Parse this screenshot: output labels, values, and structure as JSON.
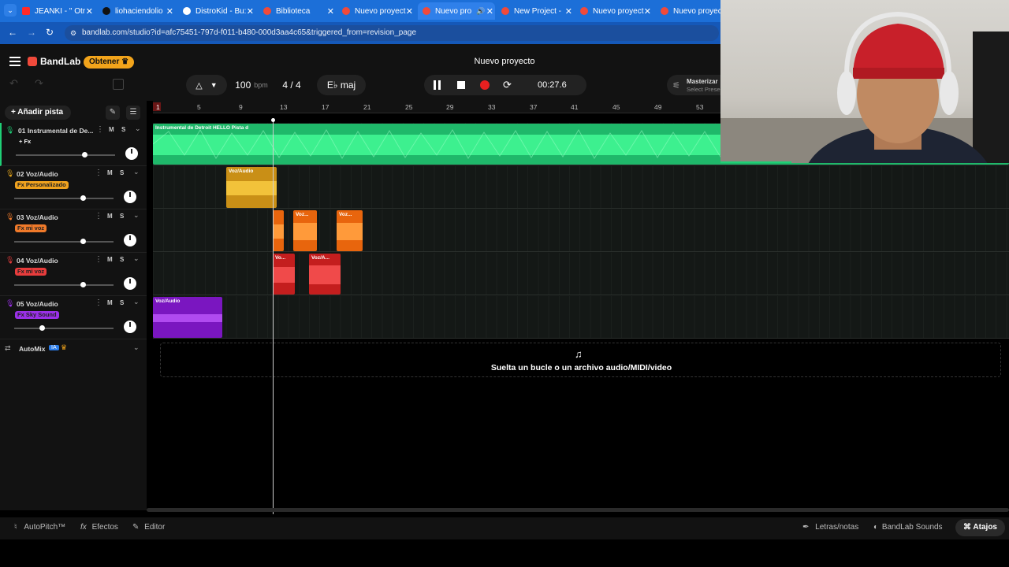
{
  "browser": {
    "tabs": [
      {
        "label": "JEANKI - \" Otr",
        "color": "#ff2a2a"
      },
      {
        "label": "liohaciendolio",
        "color": "#111111"
      },
      {
        "label": "DistroKid - Bu:",
        "color": "#ffffff"
      },
      {
        "label": "Biblioteca",
        "color": "#f04a3b"
      },
      {
        "label": "Nuevo proyect",
        "color": "#f04a3b"
      },
      {
        "label": "Nuevo pro",
        "color": "#f04a3b"
      },
      {
        "label": "New Project - ",
        "color": "#f04a3b"
      },
      {
        "label": "Nuevo proyect",
        "color": "#f04a3b"
      },
      {
        "label": "Nuevo proyect",
        "color": "#f04a3b"
      }
    ],
    "url": "bandlab.com/studio?id=afc75451-797d-f011-b480-000d3aa4c65&triggered_from=revision_page"
  },
  "app": {
    "logo": "BandLab",
    "obtener": "Obtener",
    "project_title": "Nuevo proyecto",
    "bpm_value": "100",
    "bpm_unit": "bpm",
    "time_sig": "4 / 4",
    "key": "E♭ maj",
    "time": "00:27.6",
    "mastering_title": "Masterizar",
    "mastering_sub": "Select Prese"
  },
  "sidebar": {
    "add_track": "Añadir pista",
    "tracks": [
      {
        "name": "01  Instrumental de De...",
        "fx": "+ Fx",
        "fx_color": "#ffffff",
        "m": "M",
        "s": "S",
        "volume": 0.68
      },
      {
        "name": "02  Voz/Audio",
        "fx": "Fx Personalizado",
        "fx_color": "#f0a21e",
        "m": "M",
        "s": "S",
        "volume": 0.68
      },
      {
        "name": "03  Voz/Audio",
        "fx": "Fx mi voz",
        "fx_color": "#f07a2a",
        "m": "M",
        "s": "S",
        "volume": 0.68
      },
      {
        "name": "04  Voz/Audio",
        "fx": "Fx mi voz",
        "fx_color": "#e83c3c",
        "m": "M",
        "s": "S",
        "volume": 0.68
      },
      {
        "name": "05  Voz/Audio",
        "fx": "Fx Sky Sound",
        "fx_color": "#9a30e8",
        "m": "M",
        "s": "S",
        "volume": 0.28
      }
    ],
    "automix": "AutoMix",
    "automix_badge": "IA"
  },
  "ruler": {
    "ticks": [
      "1",
      "5",
      "9",
      "13",
      "17",
      "21",
      "25",
      "29",
      "33",
      "37",
      "41",
      "45",
      "49",
      "53"
    ]
  },
  "clips": {
    "track1": "Instrumental de Detroit  HELLO Pista  d",
    "track2": "Voz/Audio",
    "track3a": "Voz...",
    "track3b": "Voz...",
    "track4a": "Vo...",
    "track4b": "Voz/A...",
    "track5": "Voz/Audio"
  },
  "drop_text": "Suelta un bucle o un archivo audio/MIDI/video",
  "footer": {
    "autopitch": "AutoPitch™",
    "efectos": "Efectos",
    "editor": "Editor",
    "letras": "Letras/notas",
    "sounds": "BandLab Sounds",
    "atajos": "Atajos"
  },
  "colors": {
    "accent": "#f2a41b",
    "track1": "#1fcf76",
    "track2": "#e0a21a",
    "track3": "#ff7a1a",
    "track4": "#e23030",
    "track5": "#8a1fcf"
  }
}
